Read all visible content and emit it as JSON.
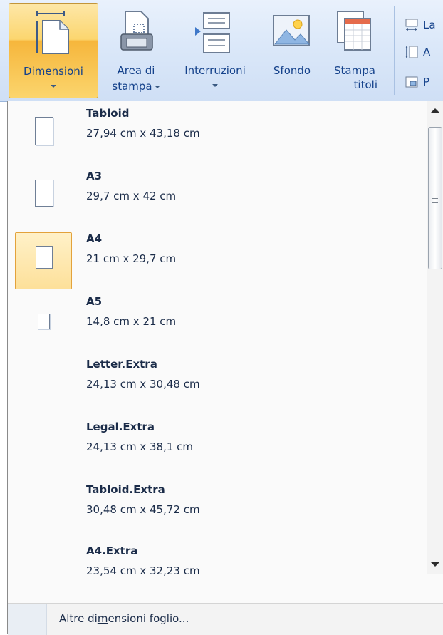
{
  "ribbon": {
    "buttons": [
      {
        "label": "Dimensioni",
        "line2": "",
        "has_dropdown": true,
        "active": true
      },
      {
        "label": "Area di",
        "line2": "stampa",
        "has_dropdown": true
      },
      {
        "label": "Interruzioni",
        "line2": "",
        "has_dropdown": true
      },
      {
        "label": "Sfondo",
        "line2": ""
      },
      {
        "label": "Stampa",
        "line2": "titoli"
      }
    ],
    "small_items": [
      {
        "label": "La",
        "icon": "width-icon"
      },
      {
        "label": "A",
        "icon": "height-icon"
      },
      {
        "label": "P",
        "icon": "scale-icon"
      }
    ]
  },
  "menu": {
    "items": [
      {
        "name": "Tabloid",
        "dims": "27,94 cm x 43,18 cm",
        "icon": "page-icon"
      },
      {
        "name": "A3",
        "dims": "29,7 cm x 42 cm",
        "icon": "page-icon"
      },
      {
        "name": "A4",
        "dims": "21 cm x 29,7 cm",
        "icon": "page-icon",
        "selected": true
      },
      {
        "name": "A5",
        "dims": "14,8 cm x 21 cm",
        "icon": "page-icon"
      },
      {
        "name": "Letter.Extra",
        "dims": "24,13 cm x 30,48 cm"
      },
      {
        "name": "Legal.Extra",
        "dims": "24,13 cm x 38,1 cm"
      },
      {
        "name": "Tabloid.Extra",
        "dims": "30,48 cm x 45,72 cm"
      },
      {
        "name": "A4.Extra",
        "dims": "23,54 cm x 32,23 cm"
      }
    ],
    "footer": {
      "link_pre": "Altre di",
      "link_accel": "m",
      "link_post": "ensioni foglio..."
    }
  },
  "colors": {
    "ribbon_bg": "#dbe8f9",
    "active_button": "#fcd66f",
    "selected_item_border": "#e3a23b",
    "text": "#15428b"
  }
}
